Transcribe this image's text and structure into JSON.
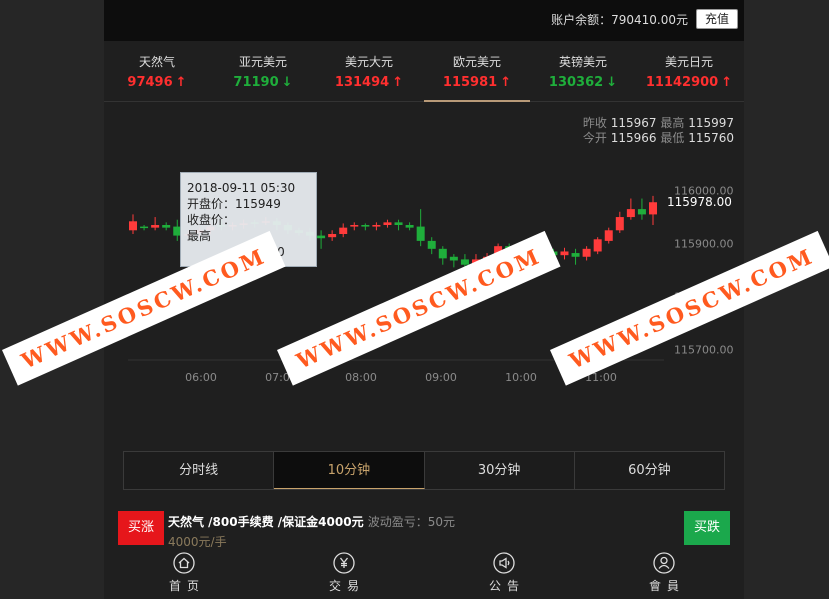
{
  "header": {
    "balance": "账户余额：790410.00元",
    "recharge_label": "充值"
  },
  "tabs": [
    {
      "name": "天然气",
      "price": "97496",
      "dir": "up"
    },
    {
      "name": "亚元美元",
      "price": "71190",
      "dir": "down"
    },
    {
      "name": "美元大元",
      "price": "131494",
      "dir": "up"
    },
    {
      "name": "欧元美元",
      "price": "115981",
      "dir": "up",
      "active": true
    },
    {
      "name": "英镑美元",
      "price": "130362",
      "dir": "down"
    },
    {
      "name": "美元日元",
      "price": "11142900",
      "dir": "up"
    }
  ],
  "stats": {
    "prev_close_label": "昨收",
    "prev_close": "115967",
    "high_label": "最高",
    "high": "115997",
    "open_label": "今开",
    "open": "115966",
    "low_label": "最低",
    "low": "115760"
  },
  "chart_data": {
    "type": "candlestick",
    "x_ticks": [
      "06:00",
      "07:00",
      "08:00",
      "09:00",
      "10:00",
      "11:00"
    ],
    "y_ticks": [
      116000,
      115900,
      115800,
      115700
    ],
    "y_tick_labels": [
      "116000.00",
      "115900.00",
      "115800.00",
      "115700.00"
    ],
    "ylim": [
      115680,
      116020
    ],
    "current_price": "115978.00",
    "up_color": "#ff3b3b",
    "down_color": "#1fae3b",
    "candles": [
      [
        115925,
        115942,
        115918,
        115955
      ],
      [
        115932,
        115930,
        115925,
        115935
      ],
      [
        115930,
        115935,
        115925,
        115950
      ],
      [
        115935,
        115930,
        115925,
        115940
      ],
      [
        115932,
        115915,
        115905,
        115945
      ],
      [
        115916,
        115918,
        115910,
        115925
      ],
      [
        115920,
        115925,
        115910,
        115930
      ],
      [
        115925,
        115932,
        115918,
        115938
      ],
      [
        115935,
        115932,
        115925,
        115945
      ],
      [
        115932,
        115935,
        115925,
        115940
      ],
      [
        115935,
        115938,
        115928,
        115945
      ],
      [
        115940,
        115938,
        115930,
        115945
      ],
      [
        115940,
        115942,
        115935,
        115950
      ],
      [
        115942,
        115935,
        115925,
        115948
      ],
      [
        115935,
        115925,
        115918,
        115940
      ],
      [
        115925,
        115920,
        115915,
        115930
      ],
      [
        115922,
        115915,
        115905,
        115930
      ],
      [
        115915,
        115910,
        115890,
        115925
      ],
      [
        115912,
        115918,
        115905,
        115925
      ],
      [
        115918,
        115930,
        115912,
        115938
      ],
      [
        115932,
        115935,
        115925,
        115940
      ],
      [
        115935,
        115932,
        115925,
        115938
      ],
      [
        115932,
        115935,
        115925,
        115940
      ],
      [
        115935,
        115940,
        115930,
        115945
      ],
      [
        115940,
        115935,
        115925,
        115945
      ],
      [
        115935,
        115930,
        115925,
        115940
      ],
      [
        115932,
        115905,
        115895,
        115965
      ],
      [
        115905,
        115890,
        115880,
        115912
      ],
      [
        115890,
        115872,
        115860,
        115895
      ],
      [
        115875,
        115868,
        115855,
        115880
      ],
      [
        115870,
        115860,
        115835,
        115880
      ],
      [
        115862,
        115870,
        115852,
        115880
      ],
      [
        115868,
        115875,
        115860,
        115882
      ],
      [
        115872,
        115895,
        115868,
        115900
      ],
      [
        115895,
        115885,
        115875,
        115900
      ],
      [
        115885,
        115892,
        115878,
        115898
      ],
      [
        115890,
        115880,
        115870,
        115895
      ],
      [
        115882,
        115888,
        115875,
        115895
      ],
      [
        115885,
        115878,
        115865,
        115890
      ],
      [
        115878,
        115885,
        115870,
        115892
      ],
      [
        115882,
        115875,
        115860,
        115890
      ],
      [
        115875,
        115890,
        115868,
        115895
      ],
      [
        115885,
        115908,
        115880,
        115912
      ],
      [
        115905,
        115925,
        115900,
        115930
      ],
      [
        115925,
        115950,
        115920,
        115960
      ],
      [
        115950,
        115965,
        115945,
        115985
      ],
      [
        115965,
        115955,
        115945,
        115985
      ],
      [
        115955,
        115978,
        115935,
        115990
      ]
    ]
  },
  "tooltip": {
    "time": "2018-09-11 05:30",
    "open_label": "开盘价：",
    "open": "115949",
    "close_label": "收盘价：",
    "close": "",
    "high_label": "最高",
    "high": "",
    "low_label": "",
    "low": "115940"
  },
  "periods": [
    {
      "label": "分时线"
    },
    {
      "label": "10分钟",
      "active": true
    },
    {
      "label": "30分钟"
    },
    {
      "label": "60分钟"
    }
  ],
  "trade": {
    "buy_up": "买涨",
    "buy_down": "买跌",
    "product": "天然气 /800手续费 /保证金4000元",
    "float_label": "波动盈亏：50元",
    "unit": "4000元/手"
  },
  "nav": [
    {
      "label": "首页",
      "icon": "home-icon"
    },
    {
      "label": "交易",
      "icon": "yen-icon"
    },
    {
      "label": "公告",
      "icon": "megaphone-icon"
    },
    {
      "label": "會員",
      "icon": "user-icon"
    }
  ],
  "watermark": {
    "text": "WWW.SOSCW.COM"
  }
}
